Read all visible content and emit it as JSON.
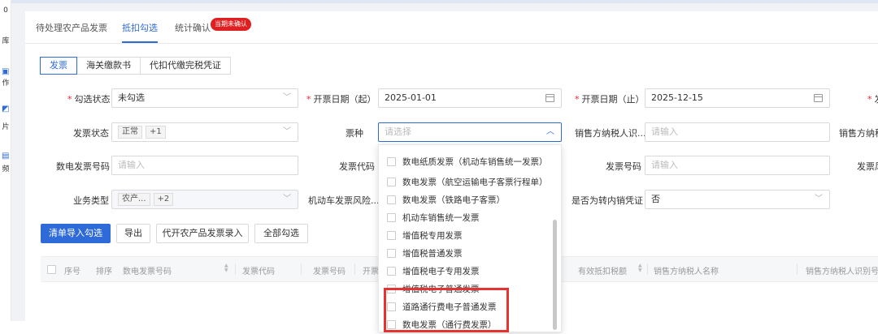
{
  "leftnav": {
    "items": [
      "库",
      "作",
      "片",
      "频"
    ]
  },
  "tabs": [
    "待处理农产品发票",
    "抵扣勾选",
    "统计确认"
  ],
  "badge": "当期未确认",
  "segments": [
    "发票",
    "海关缴款书",
    "代扣代缴完税凭证"
  ],
  "form": {
    "select_status_label": "勾选状态",
    "select_status_value": "未勾选",
    "date_start_label": "开票日期（起）",
    "date_start_value": "2025-01-01",
    "date_end_label": "开票日期（止）",
    "date_end_value": "2025-12-15",
    "cut_label": "发",
    "invoice_status_label": "发票状态",
    "invoice_status_tag": "正常",
    "invoice_status_more": "+1",
    "ticket_type_label": "票种",
    "ticket_type_placeholder": "请选择",
    "seller_id_label": "销售方纳税人识...",
    "seller_id_placeholder": "请输入",
    "seller_name_cut": "销售方纳税",
    "e_invoice_no_label": "数电发票号码",
    "e_invoice_no_placeholder": "请输入",
    "invoice_code_label": "发票代码",
    "invoice_no_label": "发票号码",
    "invoice_no_placeholder": "请输入",
    "invoice_risk_cut": "发票风",
    "biz_type_label": "业务类型",
    "biz_type_tag": "农产...",
    "biz_type_more": "+2",
    "vehicle_risk_label": "机动车发票风险...",
    "transfer_label": "是否为转内销凭证",
    "transfer_value": "否"
  },
  "buttons": [
    "清单导入勾选",
    "导出",
    "代开农产品发票录入",
    "全部勾选"
  ],
  "table": {
    "headers": [
      "序号",
      "排序",
      "数电发票号码",
      "发票代码",
      "发票号码",
      "开票",
      "有效抵扣税额",
      "销售方纳税人名称",
      "销售方纳税人识别号"
    ]
  },
  "dropdown": {
    "options": [
      "数电纸质发票（机动车销售统一发票）",
      "数电发票（航空运输电子客票行程单）",
      "数电发票（铁路电子客票）",
      "机动车销售统一发票",
      "增值税专用发票",
      "增值税普通发票",
      "增值税电子专用发票",
      "增值税电子普通发票",
      "道路通行费电子普通发票",
      "数电发票（通行费发票）"
    ]
  },
  "colors": {
    "primary": "#2f6bd8",
    "highlight": "#e53232"
  }
}
